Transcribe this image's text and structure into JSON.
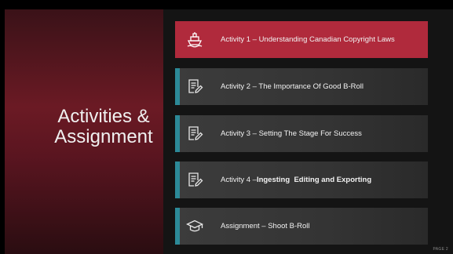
{
  "slide": {
    "title_line1": "Activities &",
    "title_line2": "Assignment",
    "page_label": "PAGE 2",
    "colors": {
      "accent_red": "#b02a3c",
      "accent_teal": "#2c8a98"
    }
  },
  "items": [
    {
      "label": "Activity 1 – Understanding Canadian Copyright Laws",
      "icon": "ship-icon",
      "active": true
    },
    {
      "label": "Activity 2 – The Importance Of Good B-Roll",
      "icon": "document-edit-icon",
      "active": false
    },
    {
      "label": "Activity 3 – Setting The Stage For Success",
      "icon": "document-edit-icon",
      "active": false
    },
    {
      "label_prefix": "Activity 4 – ",
      "label_bold": "Ingesting  Editing and Exporting",
      "icon": "document-edit-icon",
      "active": false
    },
    {
      "label": "Assignment – Shoot B-Roll",
      "icon": "graduation-cap-icon",
      "active": false
    }
  ]
}
